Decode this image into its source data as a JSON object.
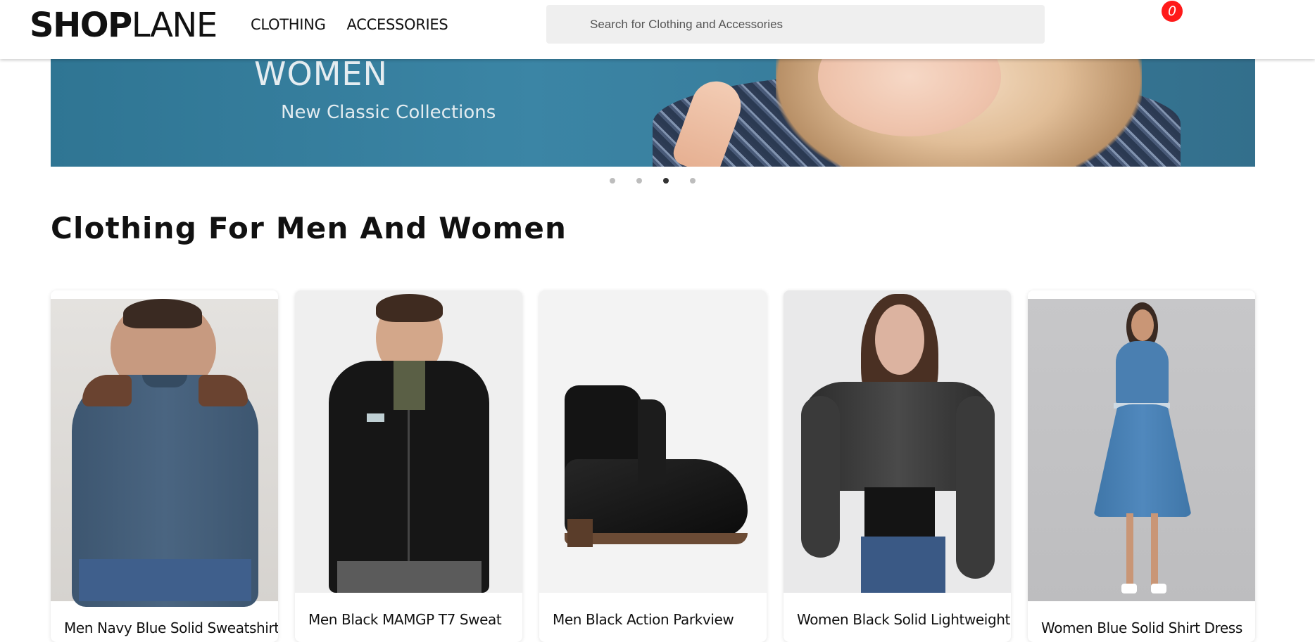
{
  "header": {
    "logo_bold": "SHOP",
    "logo_light": "LANE",
    "nav": [
      "CLOTHING",
      "ACCESSORIES"
    ],
    "search_placeholder": "Search for Clothing and Accessories",
    "cart_count": "0"
  },
  "banner": {
    "title": "WOMEN",
    "subtitle": "New Classic Collections",
    "slides": 4,
    "active_slide": 3
  },
  "section": {
    "title": "Clothing For Men And Women"
  },
  "products": [
    {
      "name": "Men Navy Blue Solid Sweatshirt"
    },
    {
      "name": "Men Black MAMGP T7 Sweat"
    },
    {
      "name": "Men Black Action Parkview"
    },
    {
      "name": "Women Black Solid Lightweight"
    },
    {
      "name": "Women Blue Solid Shirt Dress"
    }
  ],
  "colors": {
    "accent_badge": "#ff1a1a",
    "banner_bg": "#3b85a5"
  }
}
